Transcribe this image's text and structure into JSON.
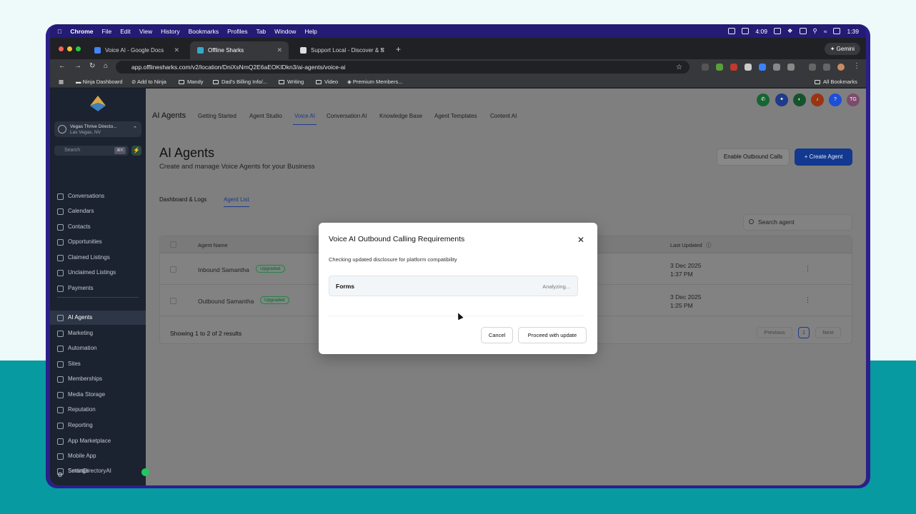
{
  "menubar": {
    "items": [
      "Chrome",
      "File",
      "Edit",
      "View",
      "History",
      "Bookmarks",
      "Profiles",
      "Tab",
      "Window",
      "Help"
    ],
    "clock_small": "4:09",
    "time": "1:39"
  },
  "browser": {
    "tabs": [
      {
        "title": "Voice AI - Google Docs"
      },
      {
        "title": "Offline Sharks"
      },
      {
        "title": "Support Local - Discover & S"
      }
    ],
    "gemini_label": "Gemini",
    "url": "app.offlinesharks.com/v2/location/DniXsNmQ2E6aEOKIDkn3/ai-agents/voice-ai",
    "bookmarks": [
      "Ninja Dashboard",
      "Add to Ninja",
      "Mandy",
      "Dad's Billing Info/...",
      "Writing",
      "Video",
      "Premium Members..."
    ],
    "all_bookmarks": "All Bookmarks"
  },
  "sidebar": {
    "location_name": "Vegas Thrive Directo...",
    "location_sub": "Las Vegas, NV",
    "search_placeholder": "Search",
    "search_kbd": "⌘K",
    "items": [
      {
        "label": "Conversations"
      },
      {
        "label": "Calendars"
      },
      {
        "label": "Contacts"
      },
      {
        "label": "Opportunities"
      },
      {
        "label": "Claimed Listings"
      },
      {
        "label": "Unclaimed Listings"
      },
      {
        "label": "Payments"
      },
      {
        "label": "AI Agents"
      },
      {
        "label": "Marketing"
      },
      {
        "label": "Automation"
      },
      {
        "label": "Sites"
      },
      {
        "label": "Memberships"
      },
      {
        "label": "Media Storage"
      },
      {
        "label": "Reputation"
      },
      {
        "label": "Reporting"
      },
      {
        "label": "App Marketplace"
      },
      {
        "label": "Mobile App"
      },
      {
        "label": "SmartDirectoryAI"
      },
      {
        "label": "Settings"
      }
    ]
  },
  "header": {
    "brand": "AI Agents",
    "tabs": [
      {
        "label": "Getting Started"
      },
      {
        "label": "Agent Studio"
      },
      {
        "label": "Voice AI"
      },
      {
        "label": "Conversation AI"
      },
      {
        "label": "Knowledge Base"
      },
      {
        "label": "Agent Templates"
      },
      {
        "label": "Content AI"
      }
    ],
    "avatar": "TG"
  },
  "main": {
    "title": "AI Agents",
    "subtitle": "Create and manage Voice Agents for your Business",
    "enable_outbound": "Enable Outbound Calls",
    "create_agent": "+ Create Agent",
    "subtabs": [
      {
        "label": "Dashboard & Logs"
      },
      {
        "label": "Agent List"
      }
    ],
    "search_placeholder": "Search agent",
    "columns": {
      "name": "Agent Name",
      "updated": "Last Updated"
    },
    "rows": [
      {
        "name": "Inbound Samantha",
        "badge": "Upgraded",
        "date": "3 Dec 2025",
        "time": "1:37 PM"
      },
      {
        "name": "Outbound Samantha",
        "badge": "Upgraded",
        "date": "3 Dec 2025",
        "time": "1:25 PM"
      }
    ],
    "showing": "Showing 1 to 2 of 2 results",
    "pagination": {
      "prev": "Previous",
      "page": "1",
      "next": "Next"
    }
  },
  "modal": {
    "title": "Voice AI Outbound Calling Requirements",
    "description": "Checking updated disclosure for platform compatibility",
    "check_label": "Forms",
    "check_status": "Analyzing...",
    "cancel": "Cancel",
    "proceed": "Proceed with update"
  },
  "colors": {
    "primary": "#12388f",
    "sidebar_bg": "#1b2230",
    "menubar_bg": "#231b74",
    "backdrop_teal": "#079aa1"
  }
}
